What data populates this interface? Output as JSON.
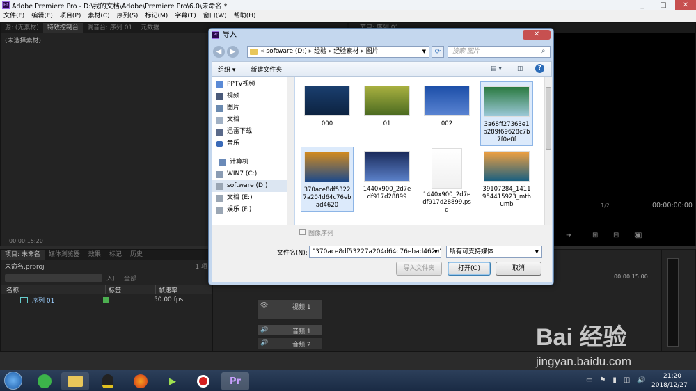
{
  "app": {
    "title": "Adobe Premiere Pro - D:\\我的文档\\Adobe\\Premiere Pro\\6.0\\未命名 *",
    "menu": [
      "文件(F)",
      "编辑(E)",
      "项目(P)",
      "素材(C)",
      "序列(S)",
      "标记(M)",
      "字幕(T)",
      "窗口(W)",
      "帮助(H)"
    ]
  },
  "source_panel": {
    "tabs": [
      "源: (无素材)",
      "特效控制台",
      "调音台: 序列 01",
      "元数据"
    ],
    "no_clip": "(未选择素材)",
    "timecode": "00:00:15:20"
  },
  "program_panel": {
    "tab": "节目: 序列 01",
    "fraction": "1/2",
    "timecode": "00:00:00:00"
  },
  "project_panel": {
    "tabs": [
      "项目: 未命名",
      "媒体浏览器",
      "效果",
      "标记",
      "历史"
    ],
    "project_name": "未命名.prproj",
    "count": "1 项",
    "in_label": "入口:",
    "in_value": "全部",
    "columns": [
      "名称",
      "标签",
      "帧速率"
    ],
    "rows": [
      {
        "name": "序列 01",
        "fps": "50.00 fps"
      }
    ]
  },
  "timeline": {
    "timecode": "00:00:15:00",
    "tracks": [
      "视频 1",
      "音频 1",
      "音频 2"
    ]
  },
  "dialog": {
    "title": "导入",
    "breadcrumb": [
      "software (D:)",
      "经验",
      "经验素材",
      "图片"
    ],
    "search_placeholder": "搜索 图片",
    "toolbar": {
      "organize": "组织",
      "new_folder": "新建文件夹"
    },
    "nav_items": [
      "PPTV视频",
      "视频",
      "图片",
      "文档",
      "迅雷下载",
      "音乐",
      "计算机",
      "WIN7 (C:)",
      "software (D:)",
      "文档 (E:)",
      "娱乐 (F:)"
    ],
    "files": [
      {
        "name": "000",
        "colors": [
          "#1a3e6e",
          "#0c2240"
        ]
      },
      {
        "name": "01",
        "colors": [
          "#a8b040",
          "#4a6a20"
        ]
      },
      {
        "name": "002",
        "colors": [
          "#1d4fa8",
          "#5a84d2"
        ]
      },
      {
        "name": "3a68ff27363e1b289f69628c7b7f0e0f",
        "colors": [
          "#2a7a40",
          "#9cc8d8"
        ]
      },
      {
        "name": "370ace8df53227a204d64c76ebad4620",
        "colors": [
          "#d08a20",
          "#1e4a8a"
        ]
      },
      {
        "name": "1440x900_2d7edf917d28899",
        "colors": [
          "#1a2a5a",
          "#5a80c8"
        ]
      },
      {
        "name": "1440x900_2d7edf917d28899.psd",
        "colors": [
          "#ffffff",
          "#f0f0f0"
        ]
      },
      {
        "name": "39107284_1411954415923_mthumb",
        "colors": [
          "#f0a040",
          "#1a6080"
        ]
      }
    ],
    "image_sequence_label": "图像序列",
    "filename_label": "文件名(N):",
    "filename_value": "\"370ace8df53227a204d64c76ebad4620\"",
    "filetype_value": "所有可支持媒体",
    "import_folder_button": "导入文件夹",
    "open_button": "打开(O)",
    "cancel_button": "取消"
  },
  "taskbar": {
    "time": "21:20",
    "date": "2018/12/27"
  },
  "watermark": {
    "brand": "Bai 经验",
    "url": "jingyan.baidu.com"
  }
}
